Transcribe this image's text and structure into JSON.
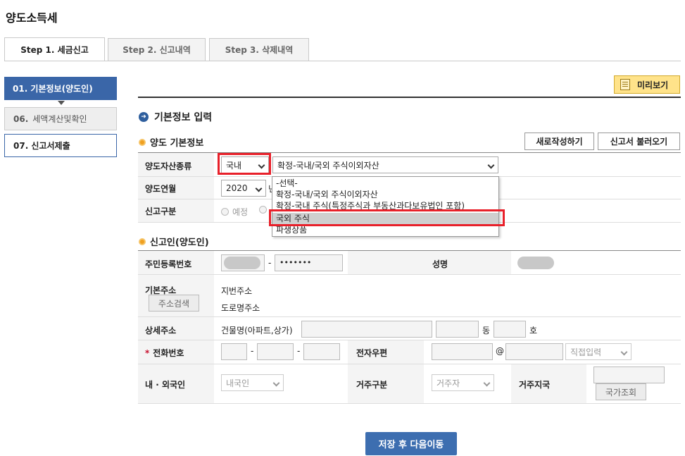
{
  "page": {
    "title": "양도소득세"
  },
  "tabs": [
    {
      "label": "Step 1. 세금신고"
    },
    {
      "label": "Step 2. 신고내역"
    },
    {
      "label": "Step 3. 삭제내역"
    }
  ],
  "nav": {
    "item1": "01. 기본정보(양도인)",
    "item2_num": "06.",
    "item2_label": "세액계산및확인",
    "item3": "07. 신고서제출"
  },
  "toolbar": {
    "preview_label": "미리보기",
    "preview_icon": "document-icon"
  },
  "section": {
    "title": "기본정보 입력",
    "transfer_title": "양도 기본정보",
    "new_write_label": "새로작성하기",
    "load_label": "신고서 불러오기",
    "reporter_title": "신고인(양도인)"
  },
  "transfer": {
    "asset_type_label": "양도자산종류",
    "asset_region_value": "국내",
    "asset_kind_value": "확정-국내/국외 주식이외자산",
    "year_label": "양도연월",
    "year_value": "2020",
    "year_suffix": "년",
    "report_type_label": "신고구분",
    "radio_scheduled": "예정"
  },
  "dropdown": {
    "options": [
      "-선택-",
      "확정-국내/국외 주식이외자산",
      "확정-국내 주식(특정주식과 부동산과다보유법인 포함)",
      "국외 주식",
      "파생상품"
    ],
    "highlighted_index": 3
  },
  "reporter": {
    "rrn_label": "주민등록번호",
    "rrn_sep": "-",
    "rrn_masked": "•••••••",
    "name_label": "성명",
    "address_label": "기본주소",
    "address_search": "주소검색",
    "jibun": "지번주소",
    "road": "도로명주소",
    "detail_label": "상세주소",
    "building": "건물명(아파트,상가)",
    "dong": "동",
    "ho": "호",
    "phone_label": "전화번호",
    "phone_star": "*",
    "dash1": "-",
    "dash2": "-",
    "email_label": "전자우편",
    "email_at": "@",
    "email_select": "직접입력",
    "nationality_label": "내 · 외국인",
    "nationality_value": "내국인",
    "residence_label": "거주구분",
    "residence_value": "거주자",
    "country_label": "거주지국",
    "country_btn": "국가조회"
  },
  "footer": {
    "save_label": "저장 후 다음이동"
  }
}
